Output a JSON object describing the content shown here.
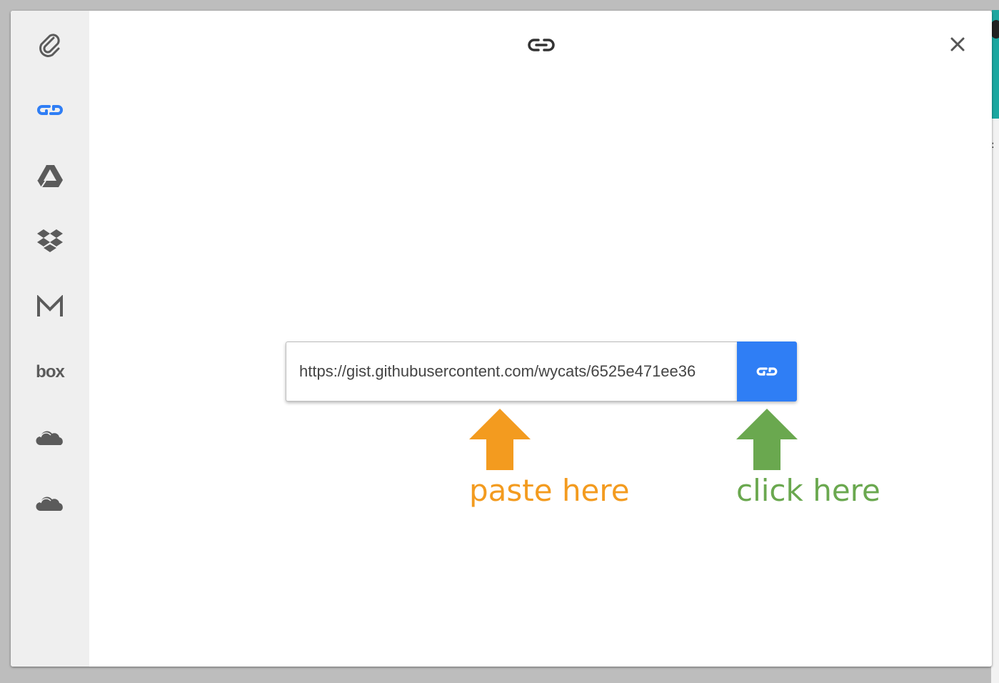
{
  "sidebar": {
    "items": [
      {
        "icon": "paperclip-icon",
        "active": false
      },
      {
        "icon": "link-icon",
        "active": true
      },
      {
        "icon": "google-drive-icon",
        "active": false
      },
      {
        "icon": "dropbox-icon",
        "active": false
      },
      {
        "icon": "gmail-icon",
        "active": false
      },
      {
        "icon": "box-icon",
        "label": "box",
        "active": false
      },
      {
        "icon": "onedrive-icon",
        "active": false
      },
      {
        "icon": "onedrive-business-icon",
        "active": false
      }
    ]
  },
  "header": {
    "icon": "link-icon"
  },
  "close": {
    "icon": "close-icon"
  },
  "url_form": {
    "value": "https://gist.githubusercontent.com/wycats/6525e471ee36",
    "button_icon": "link-icon"
  },
  "annotations": {
    "paste": {
      "text": "paste here",
      "color": "#f39b1f"
    },
    "click": {
      "text": "click here",
      "color": "#6aa84f"
    }
  },
  "colors": {
    "accent": "#2f7ef5",
    "icon_gray": "#5b5b5b",
    "sidebar_bg": "#efefef"
  }
}
